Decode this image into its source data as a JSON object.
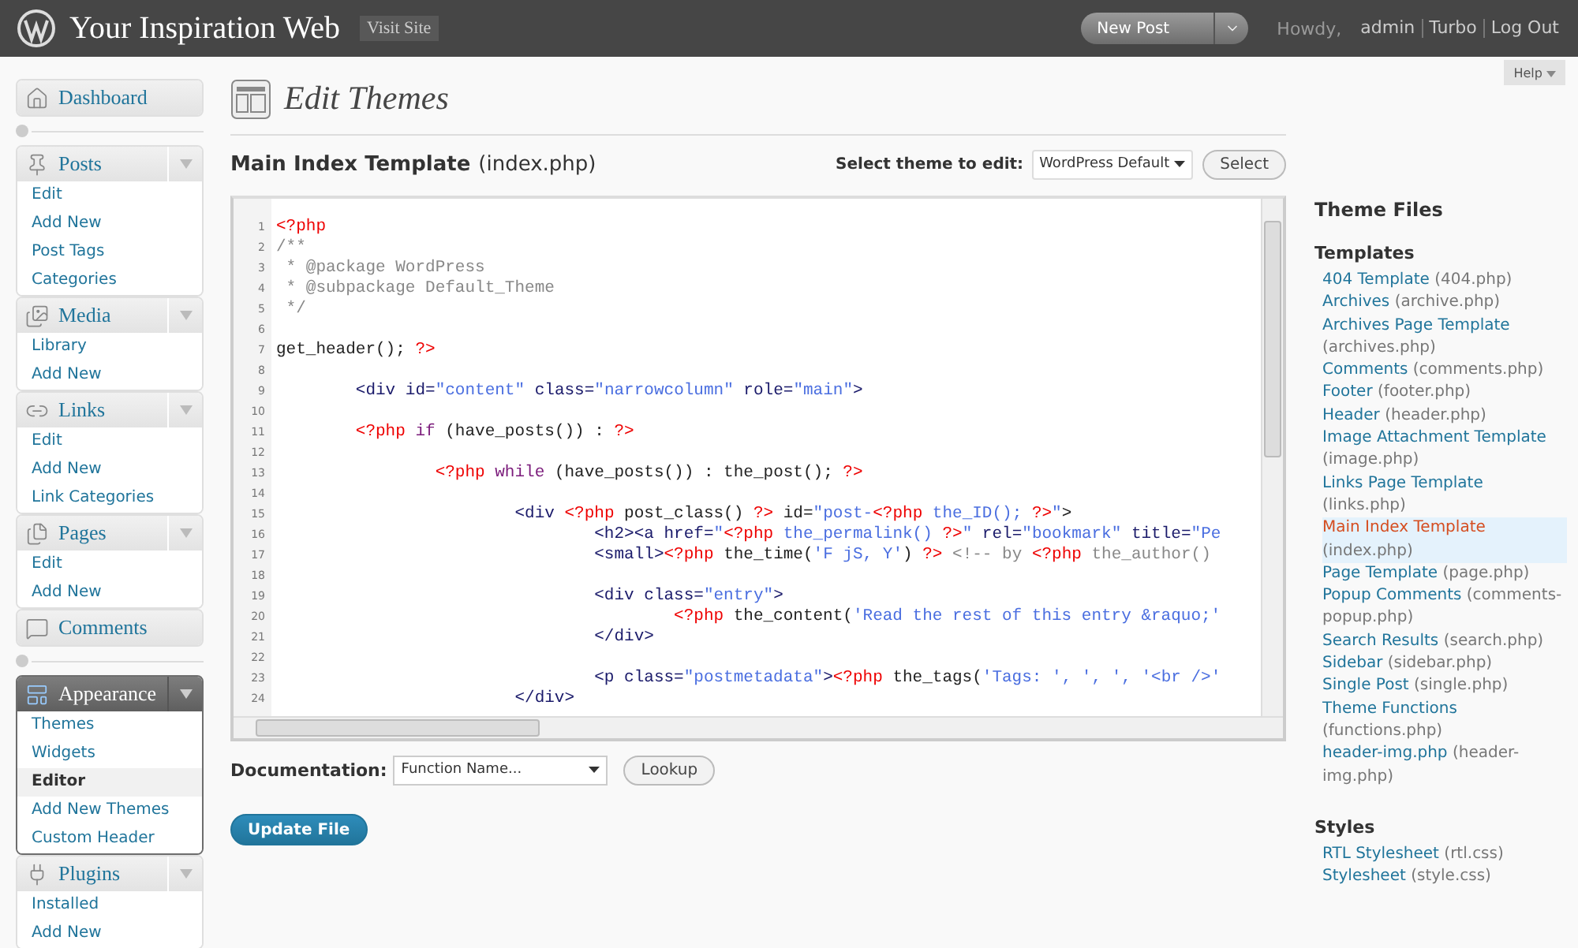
{
  "header": {
    "site_title": "Your Inspiration Web",
    "visit_site": "Visit Site",
    "new_post": "New Post",
    "howdy": "Howdy,",
    "user": "admin",
    "links": [
      "Turbo",
      "Log Out"
    ]
  },
  "sidebar": [
    {
      "label": "Dashboard",
      "current": false
    },
    {
      "label": "Posts",
      "current": false,
      "items": [
        {
          "label": "Edit",
          "selected": false
        },
        {
          "label": "Add New",
          "selected": false
        },
        {
          "label": "Post Tags",
          "selected": false
        },
        {
          "label": "Categories",
          "selected": false
        }
      ]
    },
    {
      "label": "Media",
      "current": false,
      "items": [
        {
          "label": "Library",
          "selected": false
        },
        {
          "label": "Add New",
          "selected": false
        }
      ]
    },
    {
      "label": "Links",
      "current": false,
      "items": [
        {
          "label": "Edit",
          "selected": false
        },
        {
          "label": "Add New",
          "selected": false
        },
        {
          "label": "Link Categories",
          "selected": false
        }
      ]
    },
    {
      "label": "Pages",
      "current": false,
      "items": [
        {
          "label": "Edit",
          "selected": false
        },
        {
          "label": "Add New",
          "selected": false
        }
      ]
    },
    {
      "label": "Comments",
      "current": false
    },
    {
      "label": "Appearance",
      "current": true,
      "items": [
        {
          "label": "Themes",
          "selected": false
        },
        {
          "label": "Widgets",
          "selected": false
        },
        {
          "label": "Editor",
          "selected": true
        },
        {
          "label": "Add New Themes",
          "selected": false
        },
        {
          "label": "Custom Header",
          "selected": false
        }
      ]
    },
    {
      "label": "Plugins",
      "current": false,
      "items": [
        {
          "label": "Installed",
          "selected": false
        },
        {
          "label": "Add New",
          "selected": false
        }
      ]
    }
  ],
  "page": {
    "title": "Edit Themes",
    "help": "Help",
    "file_title": "Main Index Template",
    "file_name": "(index.php)",
    "theme_label": "Select theme to edit:",
    "theme_value": "WordPress Default",
    "select_button": "Select"
  },
  "editor": {
    "lines": [
      {
        "kind": "code",
        "tokens": [
          {
            "kind": "php",
            "text": "<?php"
          }
        ]
      },
      {
        "kind": "code",
        "tokens": [
          {
            "kind": "comment",
            "text": "/**"
          }
        ]
      },
      {
        "kind": "code",
        "tokens": [
          {
            "kind": "comment",
            "text": " * @package WordPress"
          }
        ]
      },
      {
        "kind": "code",
        "tokens": [
          {
            "kind": "comment",
            "text": " * @subpackage Default_Theme"
          }
        ]
      },
      {
        "kind": "code",
        "tokens": [
          {
            "kind": "comment",
            "text": " */"
          }
        ]
      },
      {
        "kind": "blank"
      },
      {
        "kind": "code",
        "tokens": [
          {
            "kind": "plain",
            "text": "get_header(); "
          },
          {
            "kind": "php",
            "text": "?>"
          }
        ]
      },
      {
        "kind": "blank"
      },
      {
        "kind": "code",
        "tokens": [
          {
            "kind": "tag",
            "text": "        <div id="
          },
          {
            "kind": "str",
            "text": "\"content\""
          },
          {
            "kind": "tag",
            "text": " class="
          },
          {
            "kind": "str",
            "text": "\"narrowcolumn\""
          },
          {
            "kind": "tag",
            "text": " role="
          },
          {
            "kind": "str",
            "text": "\"main\""
          },
          {
            "kind": "tag",
            "text": ">"
          }
        ]
      },
      {
        "kind": "blank"
      },
      {
        "kind": "code",
        "tokens": [
          {
            "kind": "php",
            "text": "        <?php"
          },
          {
            "kind": "kw",
            "text": " if"
          },
          {
            "kind": "plain",
            "text": " (have_posts()) : "
          },
          {
            "kind": "php",
            "text": "?>"
          }
        ]
      },
      {
        "kind": "blank"
      },
      {
        "kind": "code",
        "tokens": [
          {
            "kind": "php",
            "text": "                <?php"
          },
          {
            "kind": "kw",
            "text": " while"
          },
          {
            "kind": "plain",
            "text": " (have_posts()) : the_post(); "
          },
          {
            "kind": "php",
            "text": "?>"
          }
        ]
      },
      {
        "kind": "blank"
      },
      {
        "kind": "code",
        "tokens": [
          {
            "kind": "tag",
            "text": "                        <div "
          },
          {
            "kind": "php",
            "text": "<?php"
          },
          {
            "kind": "plain",
            "text": " post_class() "
          },
          {
            "kind": "php",
            "text": "?>"
          },
          {
            "kind": "plain",
            "text": " id="
          },
          {
            "kind": "str",
            "text": "\"post-"
          },
          {
            "kind": "php",
            "text": "<?php"
          },
          {
            "kind": "str",
            "text": " the_ID(); "
          },
          {
            "kind": "php",
            "text": "?>"
          },
          {
            "kind": "str",
            "text": "\""
          },
          {
            "kind": "plain",
            "text": ">"
          }
        ]
      },
      {
        "kind": "code",
        "tokens": [
          {
            "kind": "tag",
            "text": "                                <h2><a href="
          },
          {
            "kind": "str",
            "text": "\""
          },
          {
            "kind": "php",
            "text": "<?php"
          },
          {
            "kind": "str",
            "text": " the_permalink() "
          },
          {
            "kind": "php",
            "text": "?>"
          },
          {
            "kind": "str",
            "text": "\""
          },
          {
            "kind": "tag",
            "text": " rel="
          },
          {
            "kind": "str",
            "text": "\"bookmark\""
          },
          {
            "kind": "tag",
            "text": " title="
          },
          {
            "kind": "str",
            "text": "\"Pe"
          }
        ]
      },
      {
        "kind": "code",
        "tokens": [
          {
            "kind": "tag",
            "text": "                                <small>"
          },
          {
            "kind": "php",
            "text": "<?php"
          },
          {
            "kind": "plain",
            "text": " the_time("
          },
          {
            "kind": "str",
            "text": "'F jS, Y'"
          },
          {
            "kind": "plain",
            "text": ") "
          },
          {
            "kind": "php",
            "text": "?>"
          },
          {
            "kind": "comment",
            "text": " <!-- by "
          },
          {
            "kind": "php",
            "text": "<?php"
          },
          {
            "kind": "comment",
            "text": " the_author()"
          }
        ]
      },
      {
        "kind": "blank"
      },
      {
        "kind": "code",
        "tokens": [
          {
            "kind": "tag",
            "text": "                                <div class="
          },
          {
            "kind": "str",
            "text": "\"entry\""
          },
          {
            "kind": "tag",
            "text": ">"
          }
        ]
      },
      {
        "kind": "code",
        "tokens": [
          {
            "kind": "php",
            "text": "                                        <?php"
          },
          {
            "kind": "plain",
            "text": " the_content("
          },
          {
            "kind": "str",
            "text": "'Read the rest of this entry &raquo;'"
          }
        ]
      },
      {
        "kind": "code",
        "tokens": [
          {
            "kind": "tag",
            "text": "                                </div>"
          }
        ]
      },
      {
        "kind": "blank"
      },
      {
        "kind": "code",
        "tokens": [
          {
            "kind": "tag",
            "text": "                                <p class="
          },
          {
            "kind": "str",
            "text": "\"postmetadata\""
          },
          {
            "kind": "tag",
            "text": ">"
          },
          {
            "kind": "php",
            "text": "<?php"
          },
          {
            "kind": "plain",
            "text": " the_tags("
          },
          {
            "kind": "str",
            "text": "'Tags: ', ', ', '<br />'"
          }
        ]
      },
      {
        "kind": "code",
        "tokens": [
          {
            "kind": "tag",
            "text": "                        </div>"
          }
        ]
      }
    ],
    "line_numbers": [
      "1",
      "2",
      "3",
      "4",
      "5",
      "6",
      "7",
      "8",
      "9",
      "10",
      "11",
      "12",
      "13",
      "14",
      "15",
      "16",
      "17",
      "18",
      "19",
      "20",
      "21",
      "22",
      "23",
      "24"
    ]
  },
  "documentation": {
    "label": "Documentation:",
    "placeholder": "Function Name...",
    "button": "Lookup"
  },
  "update_button": "Update File",
  "theme_files": {
    "title": "Theme Files",
    "sections": [
      {
        "title": "Templates",
        "files": [
          {
            "name": "404 Template",
            "file": "(404.php)",
            "selected": false
          },
          {
            "name": "Archives",
            "file": "(archive.php)",
            "selected": false
          },
          {
            "name": "Archives Page Template",
            "file": "(archives.php)",
            "selected": false
          },
          {
            "name": "Comments",
            "file": "(comments.php)",
            "selected": false
          },
          {
            "name": "Footer",
            "file": "(footer.php)",
            "selected": false
          },
          {
            "name": "Header",
            "file": "(header.php)",
            "selected": false
          },
          {
            "name": "Image Attachment Template",
            "file": "(image.php)",
            "selected": false
          },
          {
            "name": "Links Page Template",
            "file": "(links.php)",
            "selected": false
          },
          {
            "name": "Main Index Template",
            "file": "(index.php)",
            "selected": true
          },
          {
            "name": "Page Template",
            "file": "(page.php)",
            "selected": false
          },
          {
            "name": "Popup Comments",
            "file": "(comments-popup.php)",
            "selected": false
          },
          {
            "name": "Search Results",
            "file": "(search.php)",
            "selected": false
          },
          {
            "name": "Sidebar",
            "file": "(sidebar.php)",
            "selected": false
          },
          {
            "name": "Single Post",
            "file": "(single.php)",
            "selected": false
          },
          {
            "name": "Theme Functions",
            "file": "(functions.php)",
            "selected": false
          },
          {
            "name": "header-img.php",
            "file": "(header-img.php)",
            "selected": false
          }
        ]
      },
      {
        "title": "Styles",
        "files": [
          {
            "name": "RTL Stylesheet",
            "file": "(rtl.css)",
            "selected": false
          },
          {
            "name": "Stylesheet",
            "file": "(style.css)",
            "selected": false
          }
        ]
      }
    ]
  }
}
